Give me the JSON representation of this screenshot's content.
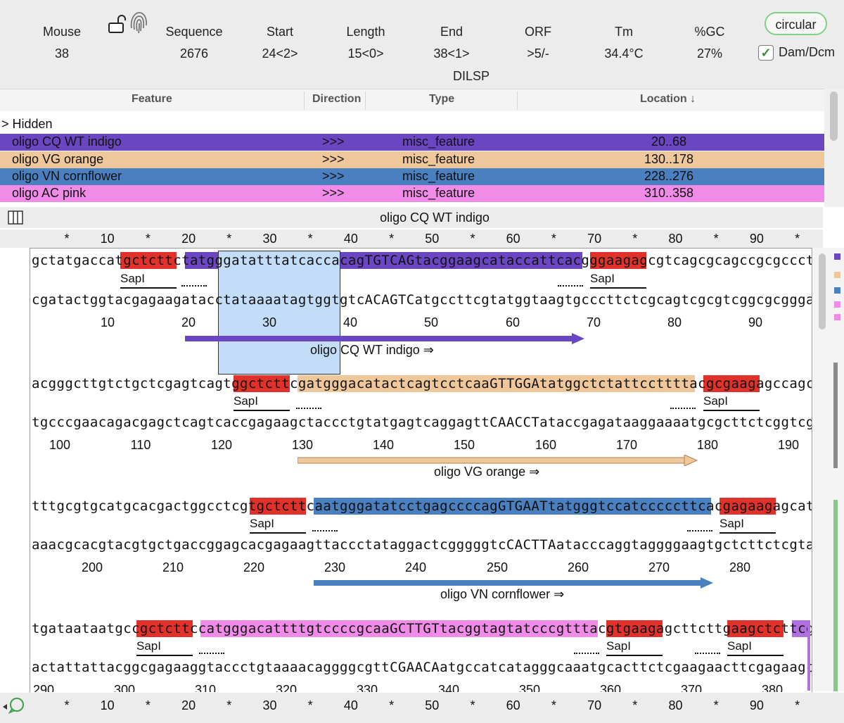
{
  "stats": [
    {
      "label": "Mouse",
      "value": "38"
    },
    {
      "label": "Sequence",
      "value": "2676"
    },
    {
      "label": "Start",
      "value": "24<2>"
    },
    {
      "label": "Length",
      "value": "15<0>"
    },
    {
      "label": "End",
      "value": "38<1>"
    },
    {
      "label": "ORF",
      "value": ">5/-"
    },
    {
      "label": "Tm",
      "value": "34.4°C"
    },
    {
      "label": "%GC",
      "value": "27%"
    }
  ],
  "dilsp": "DILSP",
  "circular_button": "circular",
  "dam_dcm": {
    "label": "Dam/Dcm",
    "checked": true
  },
  "feature_table": {
    "columns": [
      "Feature",
      "Direction",
      "Type",
      "Location ↓"
    ],
    "hidden_label": "> Hidden",
    "rows": [
      {
        "feature": "oligo CQ WT indigo",
        "direction": ">>>",
        "type": "misc_feature",
        "location": "20..68",
        "color": "#6b46c2"
      },
      {
        "feature": "oligo VG orange",
        "direction": ">>>",
        "type": "misc_feature",
        "location": "130..178",
        "color": "#eec79a"
      },
      {
        "feature": "oligo VN cornflower",
        "direction": ">>>",
        "type": "misc_feature",
        "location": "228..276",
        "color": "#4a7fc0"
      },
      {
        "feature": "oligo AC pink",
        "direction": ">>>",
        "type": "misc_feature",
        "location": "310..358",
        "color": "#f08ce8"
      }
    ]
  },
  "sequence_title": "oligo CQ WT indigo",
  "ruler_ticks": [
    "*",
    "10",
    "*",
    "20",
    "*",
    "30",
    "*",
    "40",
    "*",
    "50",
    "*",
    "60",
    "*",
    "70",
    "*",
    "80",
    "*",
    "90",
    "*"
  ],
  "enzyme": "SapI",
  "blocks": [
    {
      "top": "gctatgaccatgctcttctatgggatatttatcaccacagTGTCAGtacggaagcataccattcacgggaagagcgtcagcgcagccgcgccctg",
      "bottom": "cgatactggtacgagaagatacctataaaatagtggtgtcACAGTCatgccttcgtatggtaagtgcccttctcgcagtcgcgtcggcgcgggac",
      "numbers": [
        "10",
        "20",
        "30",
        "40",
        "50",
        "60",
        "70",
        "80",
        "90"
      ],
      "feature": "oligo CQ WT indigo ⇒"
    },
    {
      "top": "acgggcttgtctgctcgagtcagtggctcttcgatgggacatactcagtcctcaaGTTGGAtatggctctattccttttacgcgaagagccagcct",
      "bottom": "tgcccgaacagacgagctcagtcaccgagaagctaccctgtatgagtcaggagttCAACCTataccgagataaggaaaatgcgcttctcggtcgga",
      "numbers": [
        "100",
        "110",
        "120",
        "130",
        "140",
        "150",
        "160",
        "170",
        "180",
        "190"
      ],
      "feature": "oligo VG orange ⇒"
    },
    {
      "top": "tttgcgtgcatgcacgactggcctcgtgctcttcaatgggatatcctgagccccagGTGAATtatgggtccatcccccttcacgagaagagcatca",
      "bottom": "aaacgcacgtacgtgctgaccggagcacgagaagttaccctataggactcgggggtcCACTTAatacccaggtaggggaagtgctcttctcgtagt",
      "numbers": [
        "200",
        "210",
        "220",
        "230",
        "240",
        "250",
        "260",
        "270",
        "280"
      ],
      "feature": "oligo VN cornflower ⇒"
    },
    {
      "top": "tgataataatgccgctcttccatgggacattttgtccccgcaaGCTTGTtacggtagtatcccgtttacgtgaagagcttcttgaagctcttcgat",
      "bottom": "actattattacggcgagaaggtaccctgtaaaacaggggcgttCGAACAatgccatcatagggcaaatgcacttctcgaagaacttcgagaagcta",
      "numbers": [
        "290",
        "300",
        "310",
        "320",
        "330",
        "340",
        "350",
        "360",
        "370",
        "380"
      ]
    }
  ]
}
